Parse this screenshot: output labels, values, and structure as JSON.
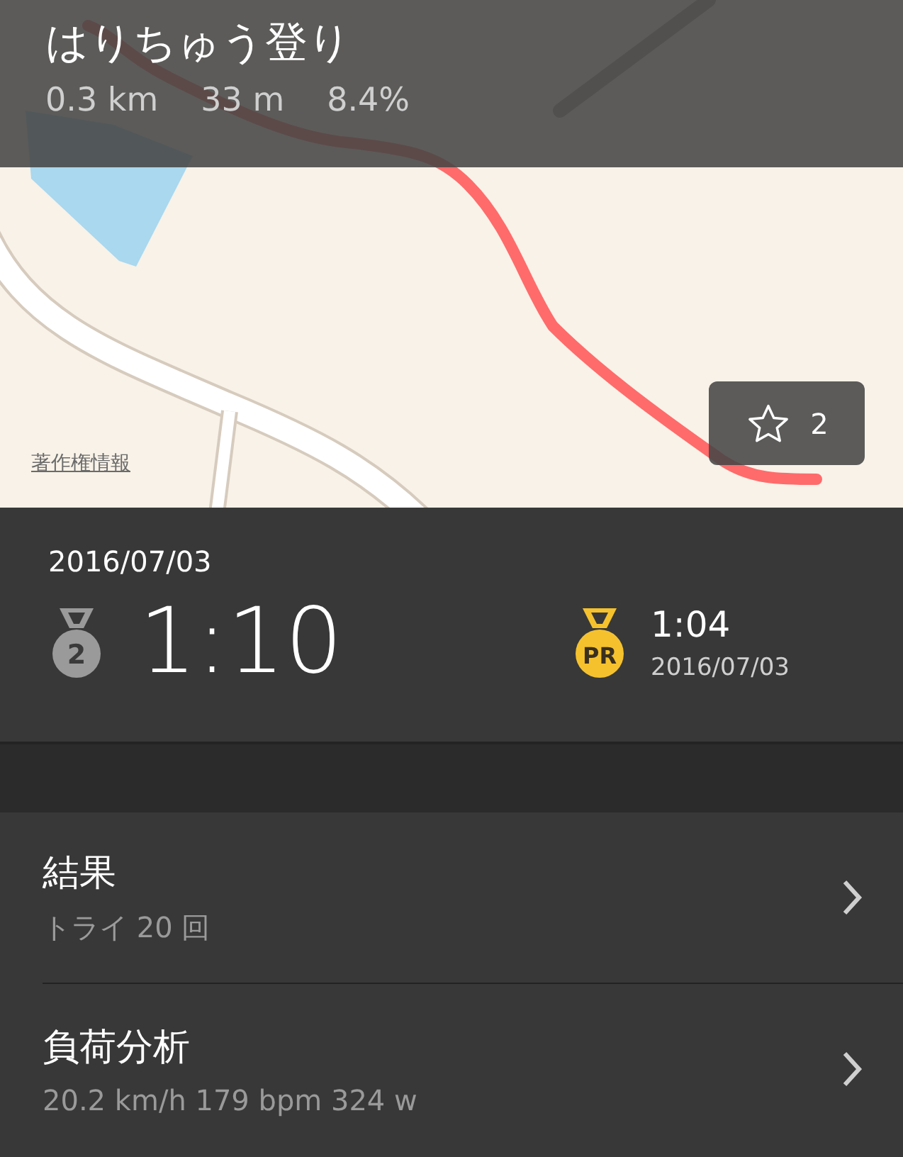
{
  "segment": {
    "title": "はりちゅう登り",
    "stats": [
      "0.3 km",
      "33 m",
      "8.4%"
    ]
  },
  "map": {
    "copyright_link": "著作権情報",
    "star_button": {
      "count": "2"
    }
  },
  "effort": {
    "date": "2016/07/03",
    "medal": {
      "kind": "silver",
      "label": "2"
    },
    "time": "1:10"
  },
  "record": {
    "medal": {
      "kind": "gold",
      "label": "PR"
    },
    "time": "1:04",
    "date": "2016/07/03"
  },
  "rows": [
    {
      "title": "結果",
      "subtitle": "トライ 20 回"
    },
    {
      "title": "負荷分析",
      "subtitle": "20.2 km/h 179 bpm 324 w"
    }
  ]
}
